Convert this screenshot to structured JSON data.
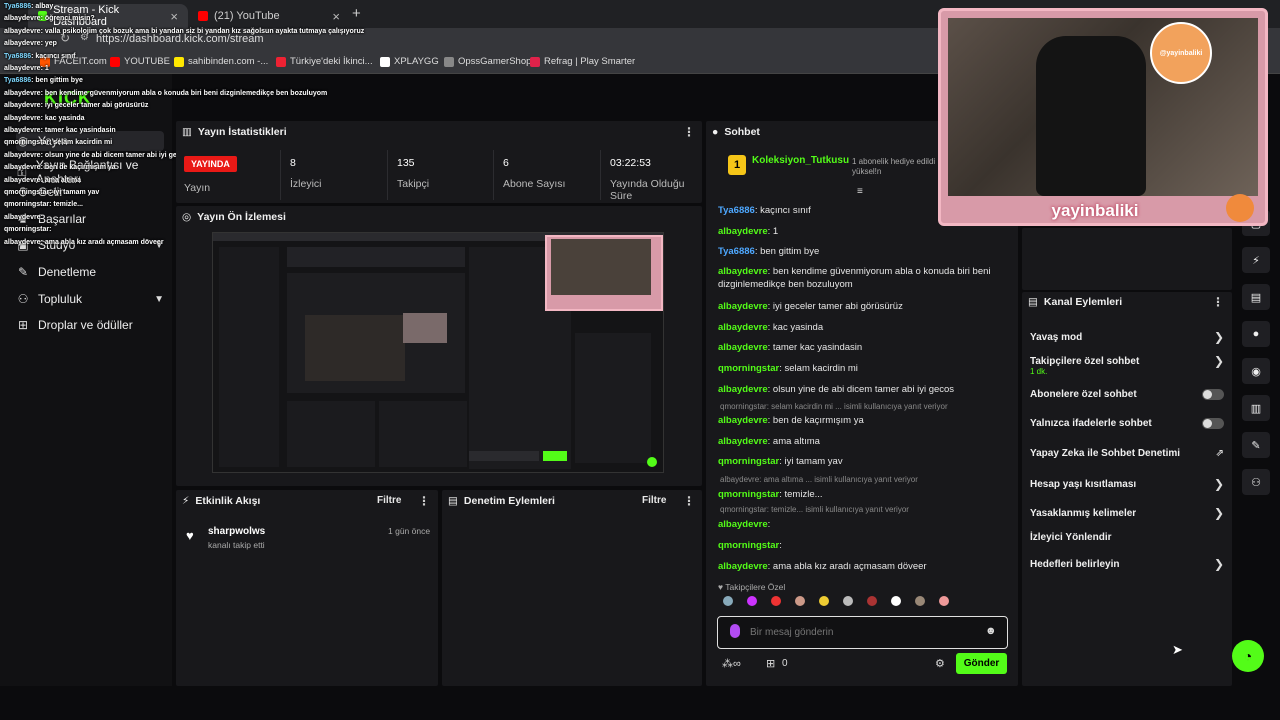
{
  "browser": {
    "tabs": [
      {
        "label": "Stream - Kick Dashboard"
      },
      {
        "label": "(21) YouTube"
      }
    ],
    "url": "https://dashboard.kick.com/stream",
    "bookmarks": [
      "FACEIT.com",
      "YOUTUBE",
      "sahibinden.com -...",
      "Türkiye'deki İkinci...",
      "XPLAYGG",
      "OpssGamerShop",
      "Refrag | Play Smarter"
    ]
  },
  "overlay_chat": [
    {
      "user": "Tya6886",
      "text": ": albay"
    },
    {
      "user": "albaydevre",
      "text": ": öğrenci misin?"
    },
    {
      "user": "albaydevre",
      "text": ": valla psikolojim çok bozuk ama bi yandan siz bi yandan kız sağolsun ayakta tutmaya çalışıyoruz"
    },
    {
      "user": "albaydevre",
      "text": ": yep"
    },
    {
      "user": "Tya6886",
      "text": ": kaçıncı sınıf"
    },
    {
      "user": "albaydevre",
      "text": ": 1"
    },
    {
      "user": "Tya6886",
      "text": ": ben gittim bye"
    },
    {
      "user": "albaydevre",
      "text": ": ben kendime güvenmiyorum abla o konuda biri beni dizginlemedikçe ben bozuluyom"
    },
    {
      "user": "albaydevre",
      "text": ": iyi geceler tamer abi görüsürüz"
    },
    {
      "user": "albaydevre",
      "text": ": kac yasinda"
    },
    {
      "user": "albaydevre",
      "text": ": tamer kac yasindasin"
    },
    {
      "user": "qmorningstar",
      "text": ": selam kacirdin mi"
    },
    {
      "user": "albaydevre",
      "text": ": olsun yine de abi dicem tamer abi iyi gecos"
    },
    {
      "user": "albaydevre",
      "text": ": ben de kaçırmışım ya"
    },
    {
      "user": "albaydevre",
      "text": ": ama altıma"
    },
    {
      "user": "qmorningstar",
      "text": ": iyi tamam yav"
    },
    {
      "user": "qmorningstar",
      "text": ": temizle..."
    },
    {
      "user": "albaydevre",
      "text": ":"
    },
    {
      "user": "qmorningstar",
      "text": ":"
    },
    {
      "user": "albaydevre",
      "text": ": ama abla kız aradı açmasam döveer"
    }
  ],
  "sidebar": {
    "logo": "KICK",
    "items": [
      {
        "label": "Yayın",
        "icon": "broadcast-icon"
      },
      {
        "label": "Yayın Bağlantısı ve Anahtarı",
        "icon": "key-icon"
      },
      {
        "label": "Gelir",
        "icon": "money-icon"
      },
      {
        "label": "Başarılar",
        "icon": "trophy-icon"
      },
      {
        "label": "Stüdyo",
        "icon": "studio-icon"
      },
      {
        "label": "Denetleme",
        "icon": "hammer-icon"
      },
      {
        "label": "Topluluk",
        "icon": "community-icon"
      },
      {
        "label": "Droplar ve ödüller",
        "icon": "gift-icon"
      }
    ]
  },
  "stats": {
    "title": "Yayın İstatistikleri",
    "live_badge": "YAYINDA",
    "items": [
      {
        "value": "",
        "label": "Yayın"
      },
      {
        "value": "8",
        "label": "İzleyici"
      },
      {
        "value": "135",
        "label": "Takipçi"
      },
      {
        "value": "6",
        "label": "Abone Sayısı"
      },
      {
        "value": "03:22:53",
        "label": "Yayında Olduğu Süre"
      }
    ]
  },
  "preview": {
    "title": "Yayın Ön İzlemesi"
  },
  "activity": {
    "title": "Etkinlik Akışı",
    "filter": "Filtre",
    "events": [
      {
        "user": "sharpwolws",
        "text": "kanalı takip etti",
        "time": "1 gün önce"
      }
    ]
  },
  "moderation": {
    "title": "Denetim Eylemleri",
    "filter": "Filtre"
  },
  "chat": {
    "title": "Sohbet",
    "pinned_user": "Koleksiyon_Tutkusu",
    "pinned_count": "1",
    "pinned_text": "1 abonelik hediye edildi · yüksel!n",
    "messages": [
      {
        "user": "Tya6886",
        "text": ": kaçıncı sınıf",
        "color": "#4ea8ff"
      },
      {
        "user": "albaydevre",
        "text": ": 1",
        "color": "#53fc18"
      },
      {
        "user": "Tya6886",
        "text": ": ben gittim bye",
        "color": "#4ea8ff"
      },
      {
        "user": "albaydevre",
        "text": ": ben kendime güvenmiyorum abla o konuda biri beni dizginlemedikçe ben bozuluyom",
        "color": "#53fc18"
      },
      {
        "user": "albaydevre",
        "text": ": iyi geceler tamer abi görüsürüz",
        "color": "#53fc18"
      },
      {
        "user": "albaydevre",
        "text": ": kac yasinda",
        "color": "#53fc18"
      },
      {
        "user": "albaydevre",
        "text": ": tamer kac yasindasin",
        "color": "#53fc18"
      },
      {
        "user": "qmorningstar",
        "text": ": selam kacirdin mi",
        "color": "#53fc18"
      },
      {
        "user": "albaydevre",
        "text": ": olsun yine de abi dicem tamer abi iyi gecos",
        "color": "#53fc18"
      },
      {
        "user": "albaydevre",
        "text": ": ben de kaçırmışım ya",
        "color": "#53fc18"
      },
      {
        "user": "albaydevre",
        "text": ": ama altıma",
        "color": "#53fc18"
      },
      {
        "user": "qmorningstar",
        "text": ": iyi tamam yav",
        "color": "#53fc18"
      },
      {
        "user": "qmorningstar",
        "text": ": temizle...",
        "color": "#53fc18"
      },
      {
        "user": "albaydevre",
        "text": ":",
        "color": "#53fc18"
      },
      {
        "user": "qmorningstar",
        "text": ":",
        "color": "#53fc18"
      },
      {
        "user": "albaydevre",
        "text": ": ama abla kız aradı açmasam döveer",
        "color": "#53fc18"
      }
    ],
    "replies": [
      "qmorningstar: selam kacirdin mi ... isimli kullanıcıya yanıt veriyor",
      "albaydevre: ama altıma ... isimli kullanıcıya yanıt veriyor",
      "qmorningstar: temizle... isimli kullanıcıya yanıt veriyor"
    ],
    "followers_label": "Takipçilere Özel",
    "input_placeholder": "Bir mesaj gönderin",
    "points": "0",
    "send_label": "Gönder"
  },
  "channel_actions": {
    "title": "Kanal Eylemleri",
    "items": [
      {
        "label": "Yavaş mod",
        "kind": "arrow"
      },
      {
        "label": "Takipçilere özel sohbet",
        "sub": "1 dk.",
        "kind": "arrow"
      },
      {
        "label": "Abonelere özel sohbet",
        "kind": "toggle"
      },
      {
        "label": "Yalnızca ifadelerle sohbet",
        "kind": "toggle"
      },
      {
        "label": "Yapay Zeka ile Sohbet Denetimi",
        "kind": "external"
      },
      {
        "label": "Hesap yaşı kısıtlaması",
        "kind": "arrow"
      },
      {
        "label": "Yasaklanmış kelimeler",
        "kind": "arrow"
      },
      {
        "label": "İzleyici Yönlendir",
        "kind": "none"
      },
      {
        "label": "Hedefleri belirleyin",
        "kind": "arrow"
      }
    ]
  },
  "webcam": {
    "name": "yayinbaliki",
    "logo_text": "@yayinbaliki"
  },
  "colors": {
    "accent": "#53fc18",
    "live": "#e91916",
    "panel": "#18181b"
  }
}
